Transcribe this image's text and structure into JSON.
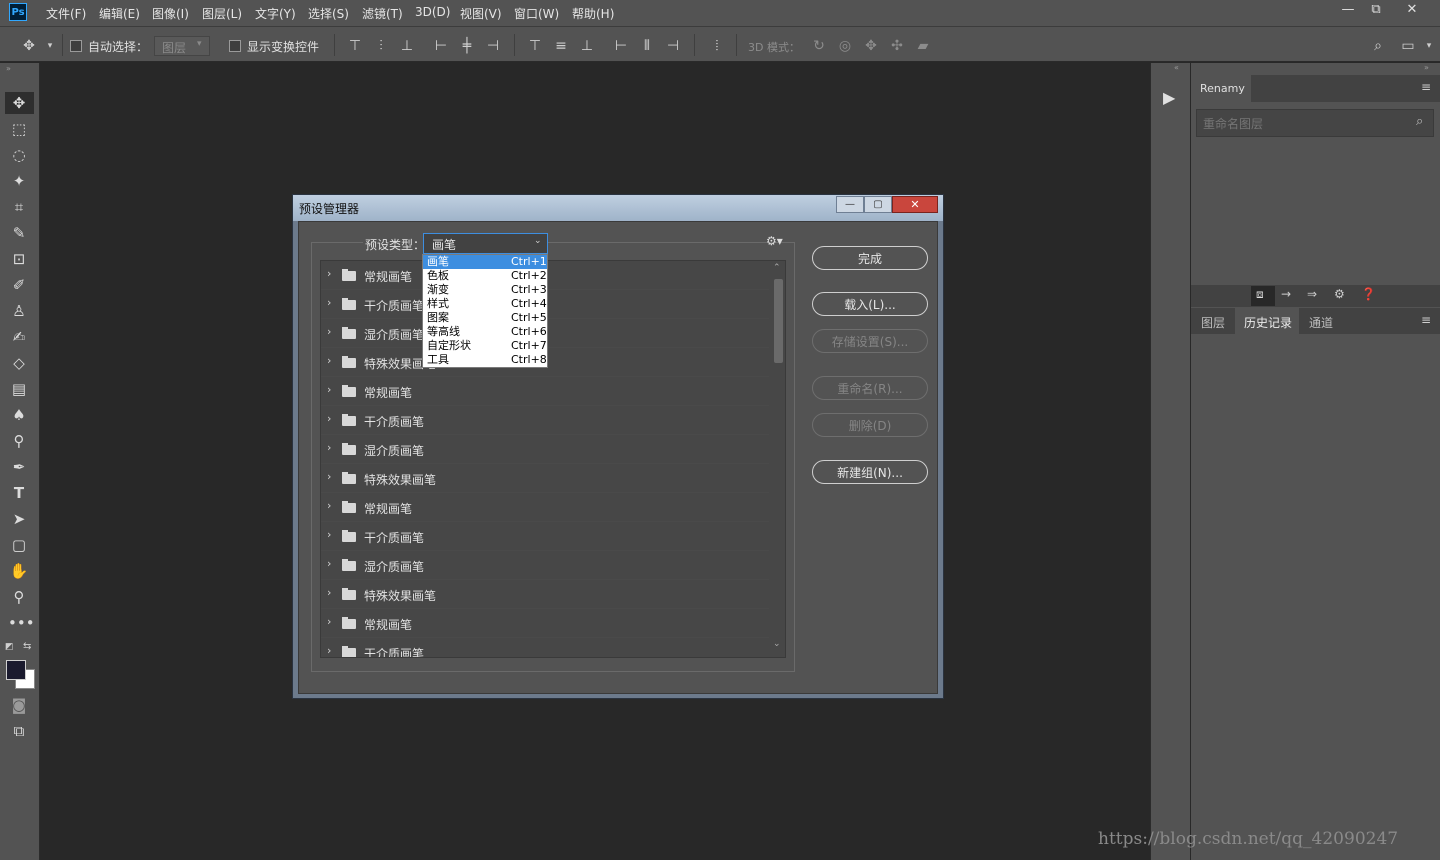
{
  "app": {
    "logo_text": "Ps"
  },
  "menu": [
    "文件(F)",
    "编辑(E)",
    "图像(I)",
    "图层(L)",
    "文字(Y)",
    "选择(S)",
    "滤镜(T)",
    "3D(D)",
    "视图(V)",
    "窗口(W)",
    "帮助(H)"
  ],
  "window_controls": {
    "minimize": "—",
    "restore": "⧉",
    "close": "✕"
  },
  "options_bar": {
    "auto_select_label": "自动选择：",
    "auto_select_value": "图层",
    "show_transform_label": "显示变换控件",
    "mode_3d_label": "3D 模式："
  },
  "right_panel": {
    "renamy_tab": "Renamy",
    "rename_placeholder": "重命名图层",
    "tabs": [
      "图层",
      "历史记录",
      "通道"
    ]
  },
  "dialog": {
    "title": "预设管理器",
    "preset_type_label": "预设类型：",
    "preset_type_value": "画笔",
    "buttons": {
      "done": "完成",
      "load": "载入(L)...",
      "save": "存储设置(S)...",
      "rename": "重命名(R)...",
      "delete": "删除(D)",
      "new_group": "新建组(N)..."
    },
    "list_items": [
      "常规画笔",
      "干介质画笔",
      "湿介质画笔",
      "特殊效果画笔",
      "常规画笔",
      "干介质画笔",
      "湿介质画笔",
      "特殊效果画笔",
      "常规画笔",
      "干介质画笔",
      "湿介质画笔",
      "特殊效果画笔",
      "常规画笔",
      "干介质画笔"
    ],
    "dropdown_options": [
      {
        "label": "画笔",
        "shortcut": "Ctrl+1"
      },
      {
        "label": "色板",
        "shortcut": "Ctrl+2"
      },
      {
        "label": "渐变",
        "shortcut": "Ctrl+3"
      },
      {
        "label": "样式",
        "shortcut": "Ctrl+4"
      },
      {
        "label": "图案",
        "shortcut": "Ctrl+5"
      },
      {
        "label": "等高线",
        "shortcut": "Ctrl+6"
      },
      {
        "label": "自定形状",
        "shortcut": "Ctrl+7"
      },
      {
        "label": "工具",
        "shortcut": "Ctrl+8"
      }
    ]
  },
  "watermark": "https://blog.csdn.net/qq_42090247",
  "colors": {
    "accent": "#3d8ee0",
    "panel": "#535353",
    "canvas": "#282828"
  }
}
